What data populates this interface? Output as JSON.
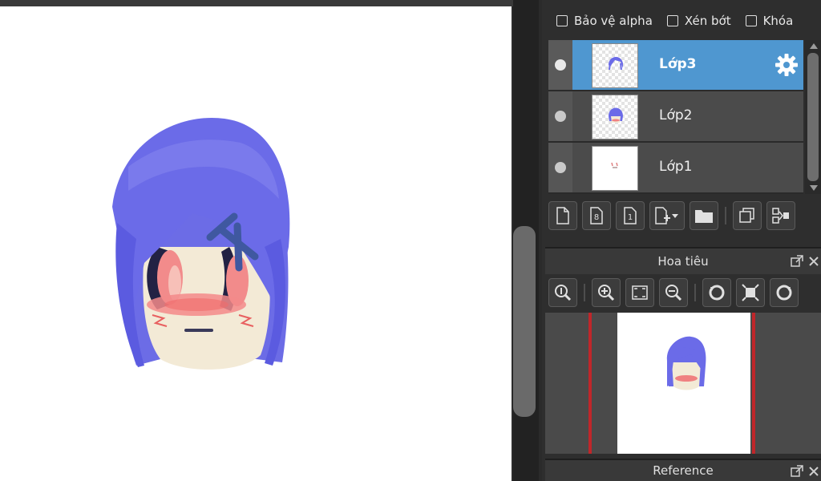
{
  "layer_options": {
    "protect_alpha": "Bảo vệ alpha",
    "clipping": "Xén bớt",
    "lock": "Khóa"
  },
  "layers": [
    {
      "name": "Lớp3",
      "active": true
    },
    {
      "name": "Lớp2",
      "active": false
    },
    {
      "name": "Lớp1",
      "active": false
    }
  ],
  "layer_toolbar_icons": [
    "new-layer-icon",
    "new-8bit-layer-icon",
    "new-1bit-layer-icon",
    "add-layer-dropdown-icon",
    "new-folder-icon",
    "duplicate-layer-icon",
    "merge-layer-icon"
  ],
  "navigator": {
    "title": "Hoa tiêu",
    "tool_icons": [
      "zoom-actual-icon",
      "zoom-in-icon",
      "fit-screen-icon",
      "zoom-out-icon",
      "rotate-left-icon",
      "reset-view-icon",
      "rotate-right-icon"
    ]
  },
  "reference": {
    "title": "Reference"
  },
  "colors": {
    "active_layer": "#4f97d0",
    "hair": "#6b6be8",
    "skin": "#f3ead6",
    "blush": "#f08080",
    "frame_red": "#c0262a"
  }
}
